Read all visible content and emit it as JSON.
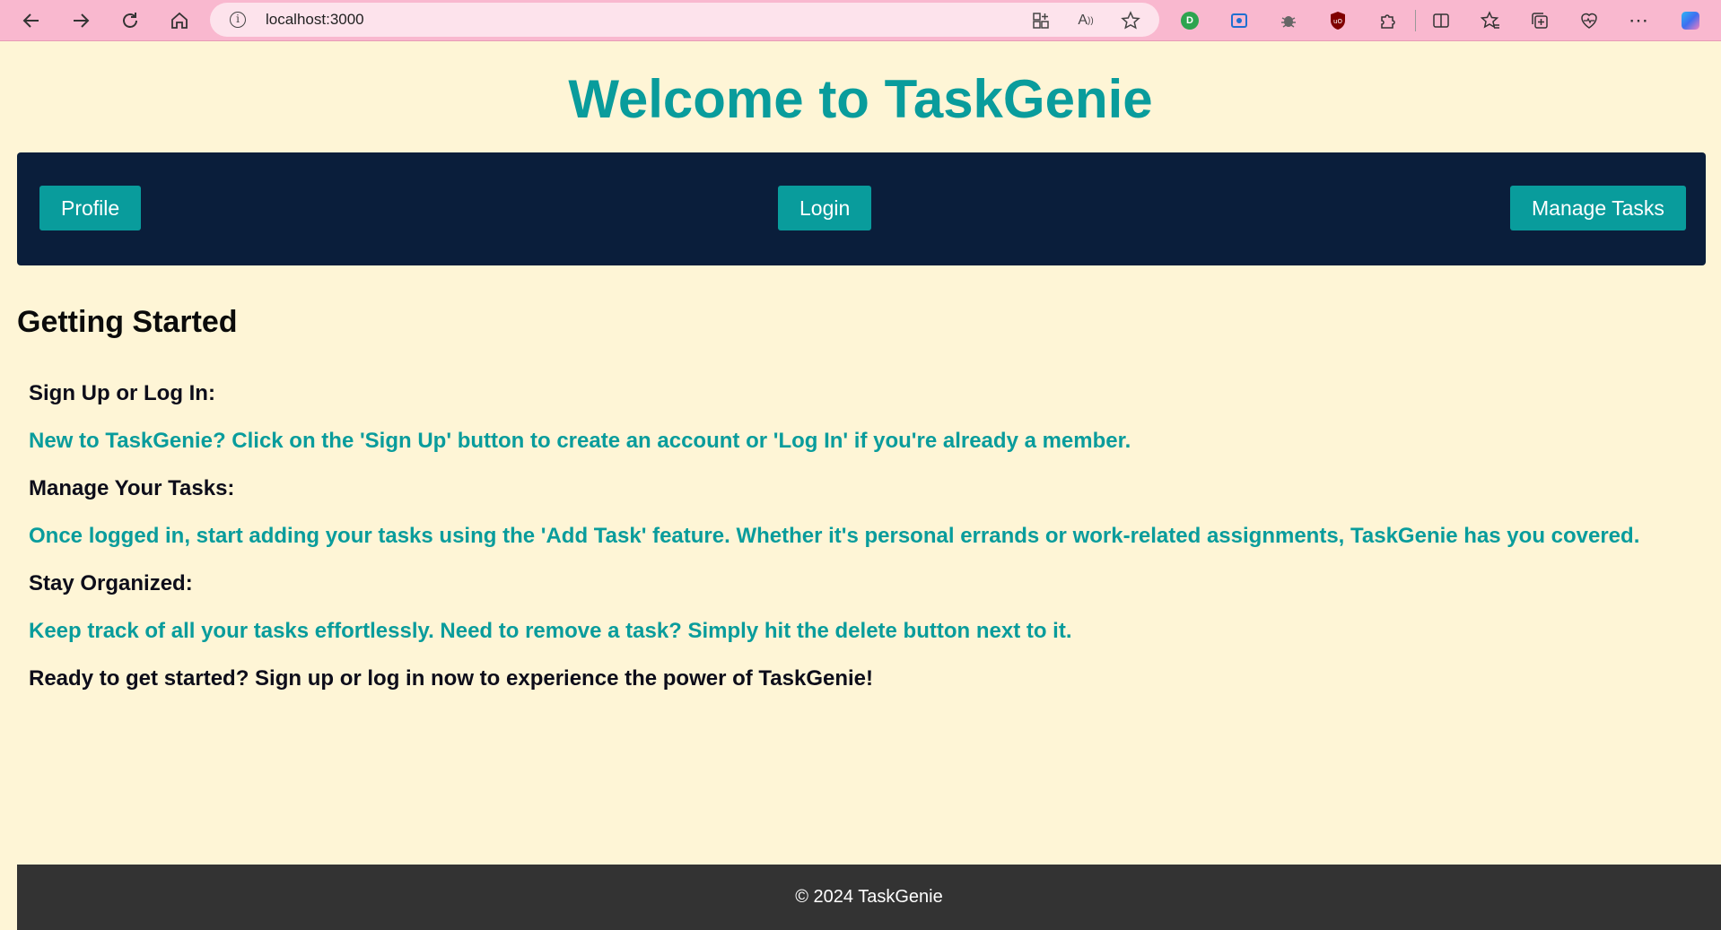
{
  "browser": {
    "url": "localhost:3000"
  },
  "page": {
    "title": "Welcome to TaskGenie"
  },
  "navbar": {
    "profile_label": "Profile",
    "login_label": "Login",
    "manage_tasks_label": "Manage Tasks"
  },
  "getting_started": {
    "heading": "Getting Started",
    "sign_up_label": "Sign Up or Log In:",
    "sign_up_desc": "New to TaskGenie? Click on the 'Sign Up' button to create an account or 'Log In' if you're already a member.",
    "manage_label": "Manage Your Tasks:",
    "manage_desc": "Once logged in, start adding your tasks using the 'Add Task' feature. Whether it's personal errands or work-related assignments, TaskGenie has you covered.",
    "organized_label": "Stay Organized:",
    "organized_desc": "Keep track of all your tasks effortlessly. Need to remove a task? Simply hit the delete button next to it.",
    "closing": "Ready to get started? Sign up or log in now to experience the power of TaskGenie!"
  },
  "footer": {
    "text": "© 2024 TaskGenie"
  },
  "colors": {
    "accent": "#099c9c",
    "navbar_bg": "#0a1e3b",
    "page_bg": "#fef5d6",
    "footer_bg": "#333333",
    "browser_bar": "#f9b8cf"
  }
}
